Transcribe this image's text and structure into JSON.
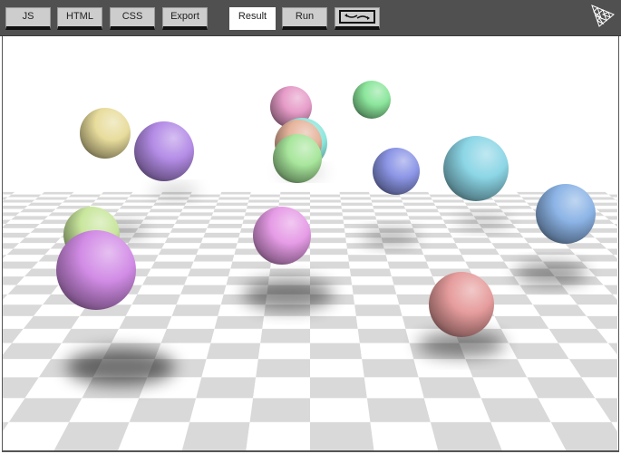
{
  "toolbar": {
    "tabs": [
      {
        "id": "js",
        "label": "JS"
      },
      {
        "id": "html",
        "label": "HTML"
      },
      {
        "id": "css",
        "label": "CSS"
      },
      {
        "id": "export",
        "label": "Export"
      }
    ],
    "result_label": "Result",
    "run_label": "Run",
    "toggle_icon": "layout-toggle-icon",
    "logo_icon": "three-logo-icon",
    "active_tab": "Result"
  },
  "scene": {
    "floor": {
      "light_color": "#ffffff",
      "dark_color": "#d9d9d9"
    },
    "spheres": [
      {
        "name": "sphere-yellow",
        "color": "#e8dc9c"
      },
      {
        "name": "sphere-purple-left",
        "color": "#b48ce6"
      },
      {
        "name": "sphere-pink-top",
        "color": "#e69cc8"
      },
      {
        "name": "sphere-green-top",
        "color": "#8ce69c"
      },
      {
        "name": "sphere-teal-back",
        "color": "#8ce6dc"
      },
      {
        "name": "sphere-peach",
        "color": "#e6b49c"
      },
      {
        "name": "sphere-green-mid",
        "color": "#a8e69c"
      },
      {
        "name": "sphere-blue-mid",
        "color": "#8c96e6"
      },
      {
        "name": "sphere-cyan",
        "color": "#8cd6e6"
      },
      {
        "name": "sphere-blue-right",
        "color": "#8cb4e6"
      },
      {
        "name": "sphere-lime",
        "color": "#c8e69c"
      },
      {
        "name": "sphere-violet-front",
        "color": "#d28ce6"
      },
      {
        "name": "sphere-magenta-mid",
        "color": "#e69ce6"
      },
      {
        "name": "sphere-red-front",
        "color": "#e69c9c"
      }
    ]
  }
}
